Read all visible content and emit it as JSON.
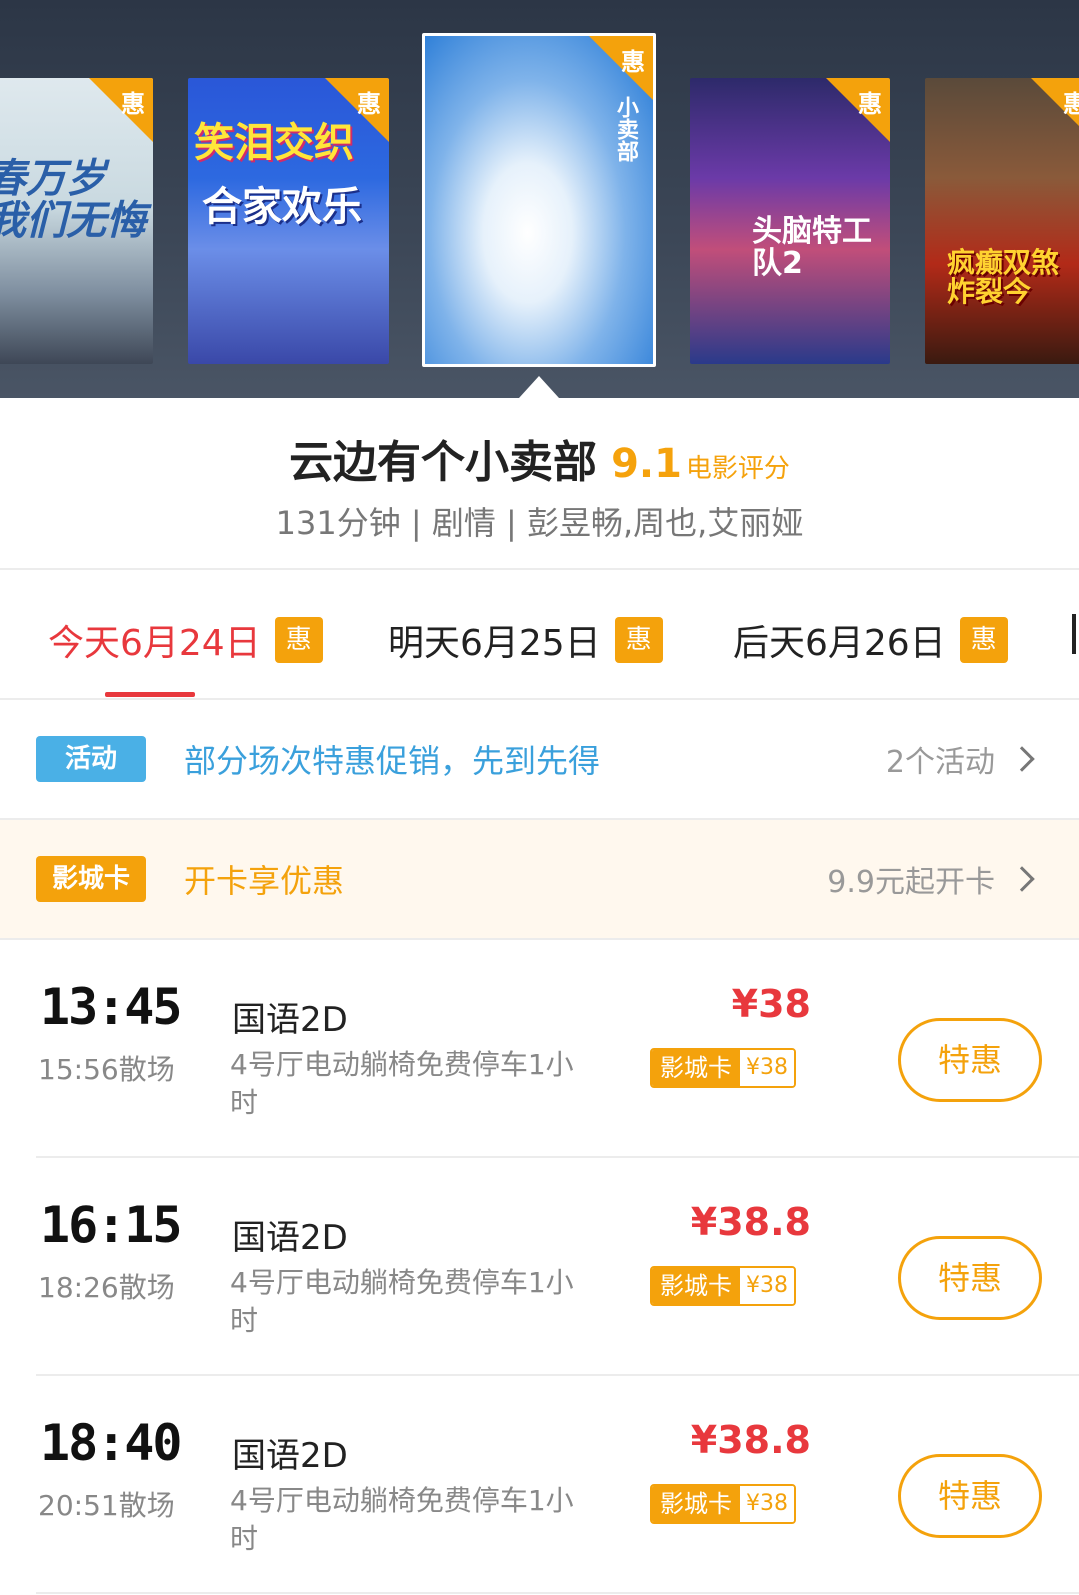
{
  "posters": [
    {
      "title": "春万岁 我们无悔",
      "tag": "惠"
    },
    {
      "title": "笑泪交织",
      "title2": "合家欢乐",
      "tag": "惠"
    },
    {
      "title": "小卖部",
      "tag": "惠"
    },
    {
      "title": "头脑特工队2",
      "tag": "惠"
    },
    {
      "title": "疯癫双煞 炸裂今",
      "tag": "惠"
    }
  ],
  "movie": {
    "title": "云边有个小卖部",
    "score": "9.1",
    "score_label": "电影评分",
    "meta": "131分钟 | 剧情 | 彭昱畅,周也,艾丽娅"
  },
  "dates": [
    {
      "label": "今天6月24日",
      "badge": "惠"
    },
    {
      "label": "明天6月25日",
      "badge": "惠"
    },
    {
      "label": "后天6月26日",
      "badge": "惠"
    }
  ],
  "activity": {
    "badge": "活动",
    "text": "部分场次特惠促销，先到先得",
    "right": "2个活动",
    "badge_color": "#4ab0e6",
    "text_color": "#3aa0dc"
  },
  "cinema_card": {
    "badge": "影城卡",
    "text": "开卡享优惠",
    "right": "9.9元起开卡",
    "badge_color": "#f4a20c",
    "bg_color": "#fff8ee"
  },
  "shows": [
    {
      "start": "13:45",
      "end": "15:56散场",
      "lang": "国语2D",
      "hall": "4号厅电动躺椅免费停车1小时",
      "price": "¥38",
      "card_label": "影城卡",
      "card_price": "¥38",
      "button": "特惠"
    },
    {
      "start": "16:15",
      "end": "18:26散场",
      "lang": "国语2D",
      "hall": "4号厅电动躺椅免费停车1小时",
      "price": "¥38.8",
      "card_label": "影城卡",
      "card_price": "¥38",
      "button": "特惠"
    },
    {
      "start": "18:40",
      "end": "20:51散场",
      "lang": "国语2D",
      "hall": "4号厅电动躺椅免费停车1小时",
      "price": "¥38.8",
      "card_label": "影城卡",
      "card_price": "¥38",
      "button": "特惠"
    }
  ],
  "colors": {
    "accent_red": "#e8383d",
    "accent_orange": "#f4a20c"
  }
}
